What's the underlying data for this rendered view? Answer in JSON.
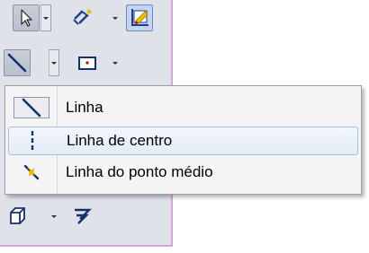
{
  "menu": {
    "items": [
      {
        "label": "Linha",
        "icon": "line-icon",
        "selected": true
      },
      {
        "label": "Linha de centro",
        "icon": "centerline-icon",
        "highlighted": true
      },
      {
        "label": "Linha do ponto médio",
        "icon": "midpoint-line-icon"
      }
    ]
  },
  "toolbar": {
    "tools": [
      "select-arrow-icon",
      "smart-dimension-icon",
      "sketch-pencil-icon",
      "line-icon",
      "rectangle-icon",
      "extruded-boss-icon",
      "extruded-cut-icon"
    ]
  },
  "colors": {
    "toolbar_bg": "#dfe2e8",
    "toolbar_border": "#d6a7d6",
    "menu_bg": "#f4f4f4",
    "highlight": "#e3ebf7",
    "accent_blue": "#1f3d8c",
    "accent_yellow": "#e8c000"
  }
}
